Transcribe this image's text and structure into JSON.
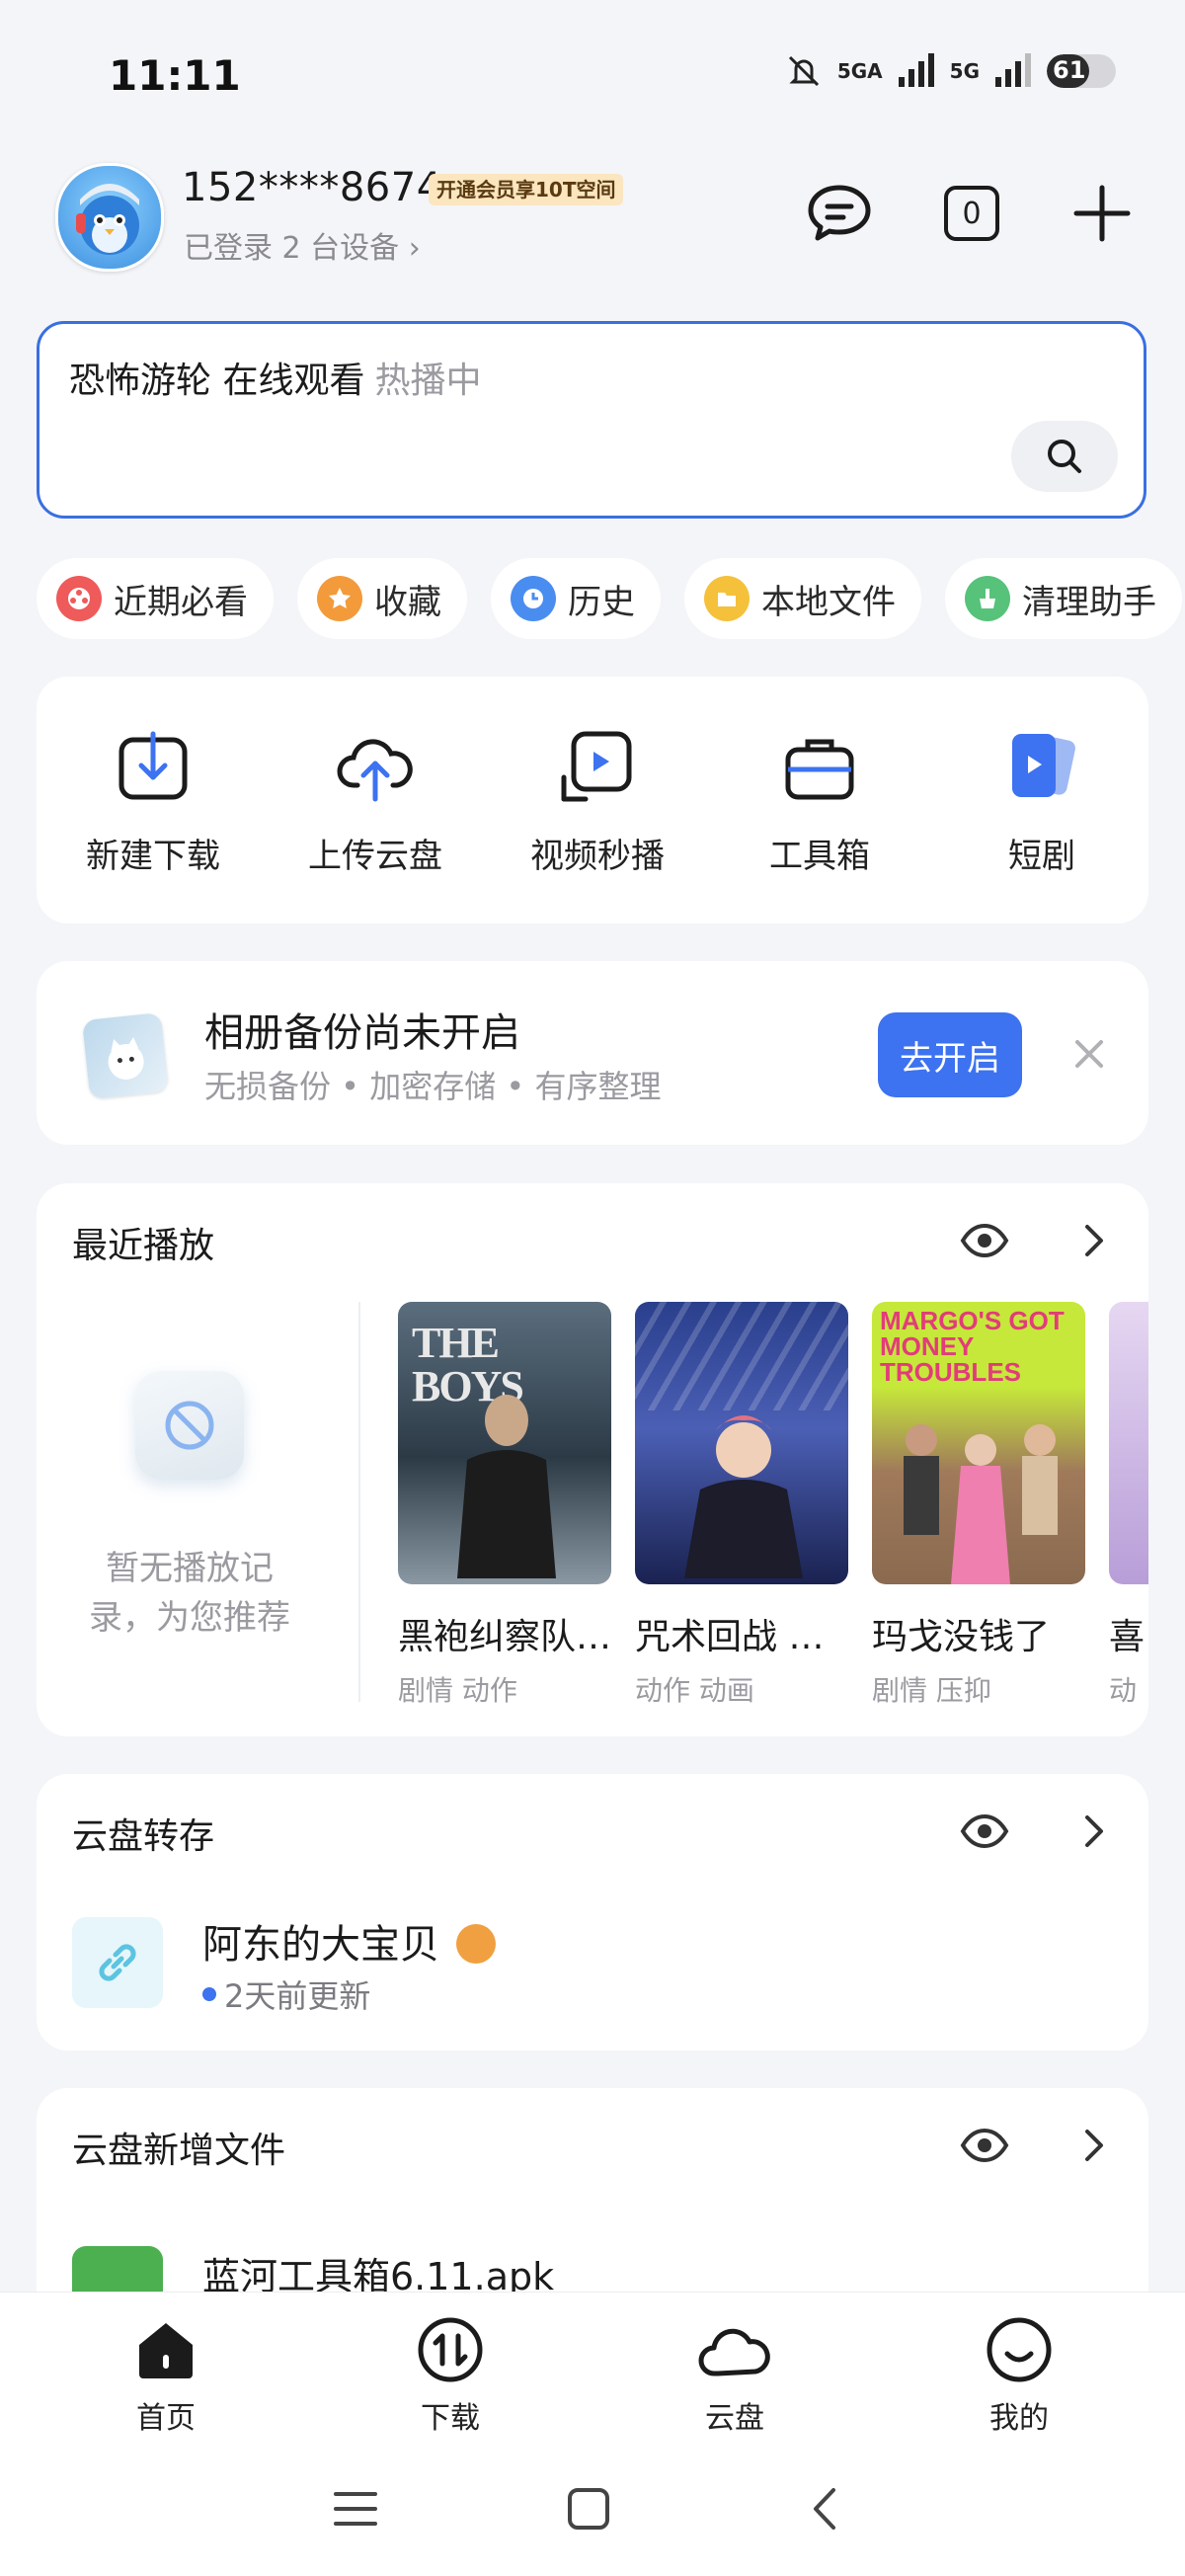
{
  "status_bar": {
    "time": "11:11",
    "signal_1": "5GA",
    "signal_2": "5G",
    "battery": "61",
    "battery_level": 0.61
  },
  "header": {
    "phone": "152****8674",
    "vip_badge": "开通会员享10T空间",
    "devices": "已登录 2 台设备 ›",
    "download_count": "0"
  },
  "search": {
    "query": "恐怖游轮 在线观看",
    "hot": "热播中"
  },
  "chips": [
    {
      "label": "近期必看",
      "color": "#ef5a5a"
    },
    {
      "label": "收藏",
      "color": "#f39a3b"
    },
    {
      "label": "历史",
      "color": "#4a8df0"
    },
    {
      "label": "本地文件",
      "color": "#f5c13b"
    },
    {
      "label": "清理助手",
      "color": "#57c27a"
    }
  ],
  "quick_actions": [
    {
      "label": "新建下载",
      "icon": "download-icon"
    },
    {
      "label": "上传云盘",
      "icon": "cloud-upload-icon"
    },
    {
      "label": "视频秒播",
      "icon": "video-play-icon"
    },
    {
      "label": "工具箱",
      "icon": "toolbox-icon"
    },
    {
      "label": "短剧",
      "icon": "short-drama-icon"
    }
  ],
  "backup": {
    "title": "相册备份尚未开启",
    "subtitle": "无损备份 • 加密存储 • 有序整理",
    "button": "去开启"
  },
  "recent_play": {
    "title": "最近播放",
    "empty_text": "暂无播放记录，为您推荐",
    "items": [
      {
        "title": "黑袍纠察队…",
        "tags": "剧情 动作",
        "poster_caption": "THE BOYS"
      },
      {
        "title": "咒术回战 …",
        "tags": "动作 动画",
        "poster_caption": ""
      },
      {
        "title": "玛戈没钱了",
        "tags": "剧情 压抑",
        "poster_caption": "MARGO'S GOT MONEY TROUBLES"
      },
      {
        "title": "喜",
        "tags": "动",
        "poster_caption": ""
      }
    ]
  },
  "cloud_transfer": {
    "title": "云盘转存",
    "item_name": "阿东的大宝贝",
    "item_time": "2天前更新"
  },
  "cloud_new_files": {
    "title": "云盘新增文件",
    "item_name": "蓝河工具箱6.11.apk"
  },
  "bottom_nav": [
    {
      "label": "首页"
    },
    {
      "label": "下载"
    },
    {
      "label": "云盘"
    },
    {
      "label": "我的"
    }
  ]
}
